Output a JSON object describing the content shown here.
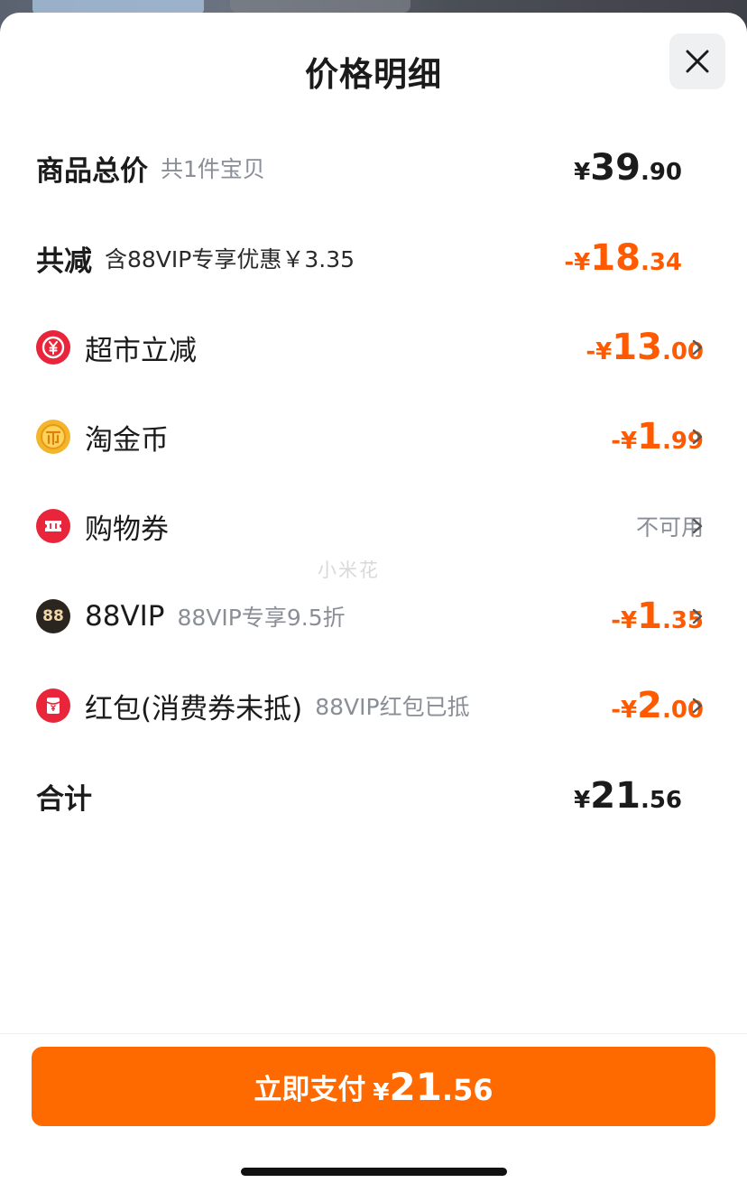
{
  "sheet": {
    "title": "价格明细"
  },
  "rows": {
    "subtotal": {
      "label": "商品总价",
      "sub": "共1件宝贝",
      "yen": "¥",
      "int": "39",
      "dec": ".90"
    },
    "discount_total": {
      "label": "共减",
      "sub": "含88VIP专享优惠￥3.35",
      "yen": "-¥",
      "int": "18",
      "dec": ".34"
    },
    "supermarket": {
      "icon": "yen-coupon-icon",
      "label": "超市立减",
      "yen": "-¥",
      "int": "13",
      "dec": ".00"
    },
    "taojinbi": {
      "icon": "gold-coin-icon",
      "label": "淘金币",
      "yen": "-¥",
      "int": "1",
      "dec": ".99"
    },
    "voucher": {
      "icon": "ticket-icon",
      "label": "购物券",
      "status": "不可用"
    },
    "vip": {
      "icon": "88vip-icon",
      "icon_text": "88",
      "label": "88VIP",
      "sub": "88VIP专享9.5折",
      "yen": "-¥",
      "int": "1",
      "dec": ".35"
    },
    "red_packet": {
      "icon": "red-packet-icon",
      "label": "红包(消费券未抵)",
      "sub": "88VIP红包已抵",
      "yen": "-¥",
      "int": "2",
      "dec": ".00"
    },
    "total": {
      "label": "合计",
      "yen": "¥",
      "int": "21",
      "dec": ".56"
    }
  },
  "watermark": "小米花",
  "pay_button": {
    "label": "立即支付",
    "yen": "¥",
    "int": "21",
    "dec": ".56"
  },
  "colors": {
    "accent": "#ff6a00",
    "discount": "#ff5a00",
    "icon_red": "#e8253a",
    "coin_gold": "#f4b42c"
  }
}
